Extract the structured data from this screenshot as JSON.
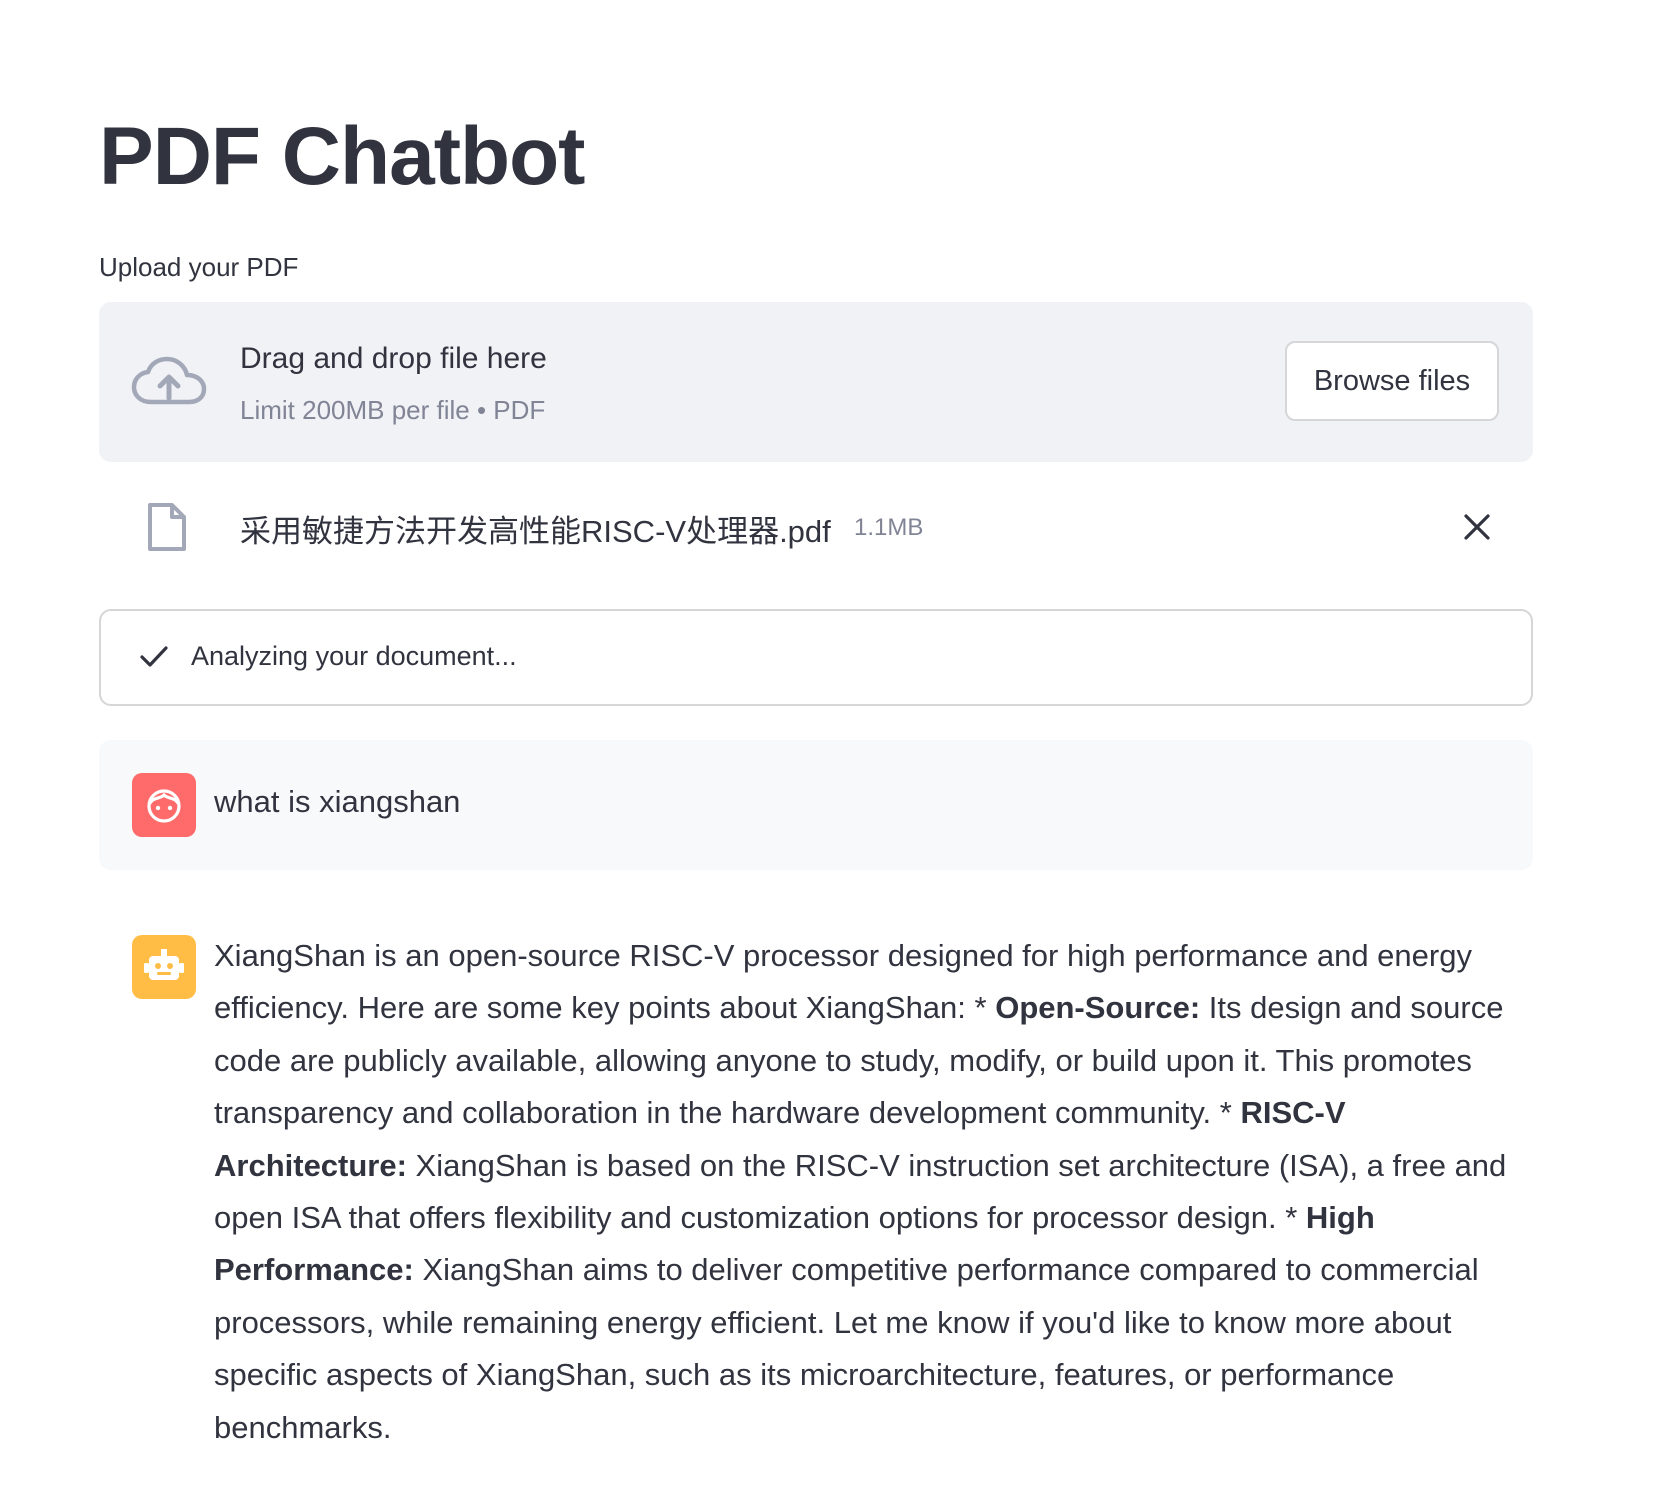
{
  "app": {
    "title": "PDF Chatbot"
  },
  "uploader": {
    "label": "Upload your PDF",
    "drop_title": "Drag and drop file here",
    "drop_subtitle": "Limit 200MB per file • PDF",
    "browse_label": "Browse files",
    "icon": "cloud-upload-icon"
  },
  "uploaded_file": {
    "name": "采用敏捷方法开发高性能RISC-V处理器.pdf",
    "size": "1.1MB",
    "icon": "file-icon",
    "remove_icon": "close-icon"
  },
  "status": {
    "text": "Analyzing your document...",
    "icon": "check-icon"
  },
  "chat": {
    "user_message": {
      "text": "what is xiangshan",
      "avatar_icon": "user-face-icon",
      "avatar_color": "#ff6b6b"
    },
    "bot_message": {
      "avatar_icon": "robot-icon",
      "avatar_color": "#ffbd45",
      "p1": "XiangShan is an open-source RISC-V processor designed for high performance and energy efficiency. Here are some key points about XiangShan: * ",
      "b1": "Open-Source:",
      "p2": " Its design and source code are publicly available, allowing anyone to study, modify, or build upon it. This promotes transparency and collaboration in the hardware development community. * ",
      "b2": "RISC-V Architecture:",
      "p3": " XiangShan is based on the RISC-V instruction set architecture (ISA), a free and open ISA that offers flexibility and customization options for processor design. * ",
      "b3": "High Performance:",
      "p4": " XiangShan aims to deliver competitive performance compared to commercial processors, while remaining energy efficient. Let me know if you'd like to know more about specific aspects of XiangShan, such as its microarchitecture, features, or performance benchmarks."
    }
  }
}
